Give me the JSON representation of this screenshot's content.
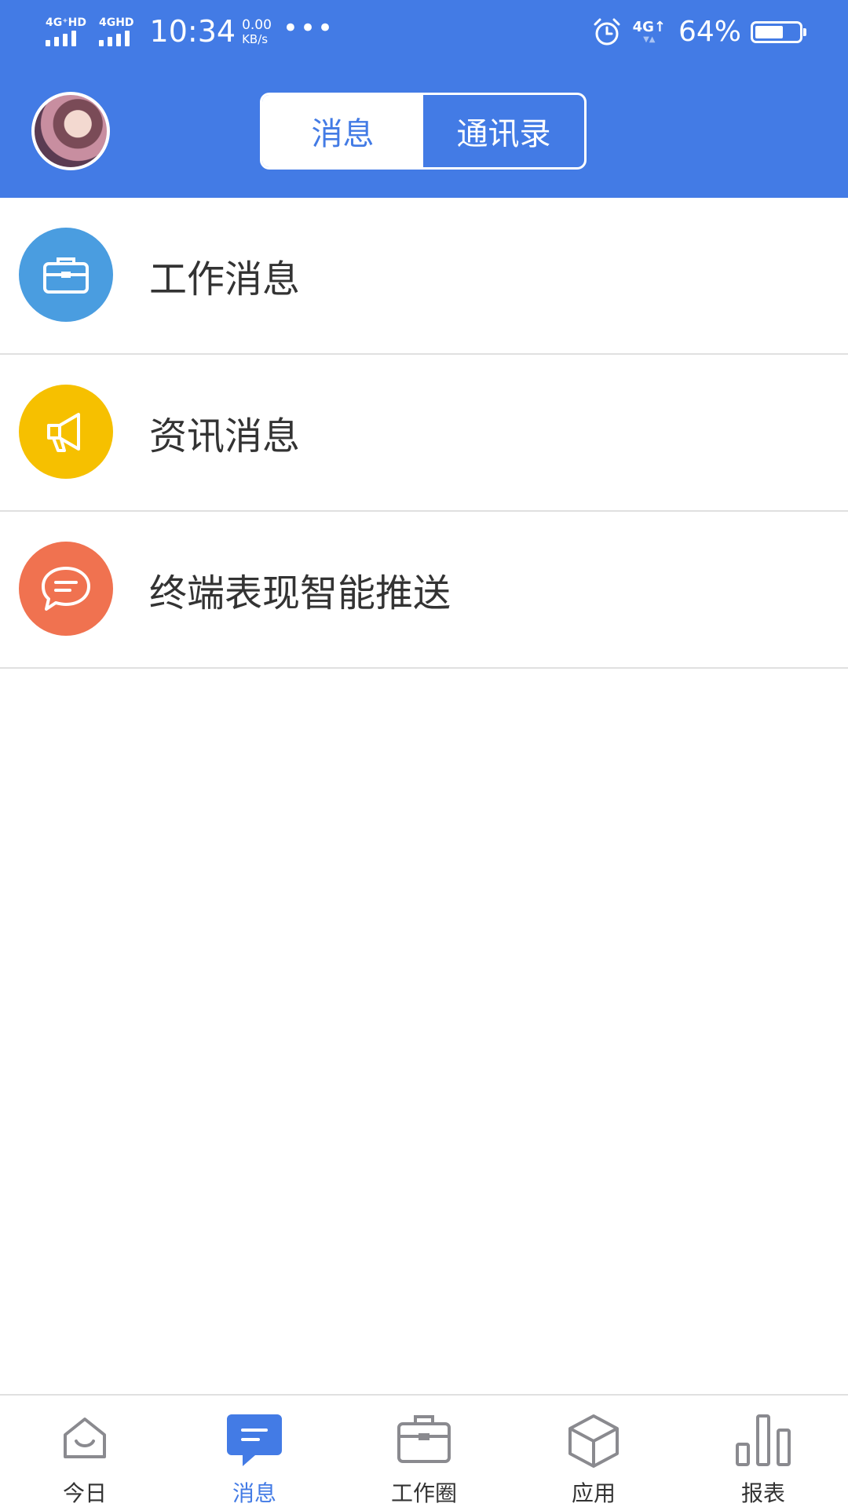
{
  "status_bar": {
    "sim1": "4G⁺HD",
    "sim2": "4GHD",
    "time": "10:34",
    "speed_value": "0.00",
    "speed_unit": "KB/s",
    "more": "•••",
    "net_right": "4G↑",
    "battery_percent": "64%",
    "battery_level": 0.64
  },
  "header": {
    "tabs": [
      {
        "label": "消息",
        "active": true
      },
      {
        "label": "通讯录",
        "active": false
      }
    ]
  },
  "list": [
    {
      "label": "工作消息",
      "icon": "briefcase-icon",
      "color": "#4a9de0"
    },
    {
      "label": "资讯消息",
      "icon": "megaphone-icon",
      "color": "#f6c000"
    },
    {
      "label": "终端表现智能推送",
      "icon": "chat-bubble-icon",
      "color": "#f07250"
    }
  ],
  "tabbar": [
    {
      "label": "今日",
      "icon": "home-icon",
      "active": false
    },
    {
      "label": "消息",
      "icon": "message-icon",
      "active": true
    },
    {
      "label": "工作圈",
      "icon": "briefcase-icon",
      "active": false
    },
    {
      "label": "应用",
      "icon": "cube-icon",
      "active": false
    },
    {
      "label": "报表",
      "icon": "bar-chart-icon",
      "active": false
    }
  ],
  "colors": {
    "primary": "#437be5",
    "divider": "#e0e0e0",
    "text": "#333333"
  }
}
